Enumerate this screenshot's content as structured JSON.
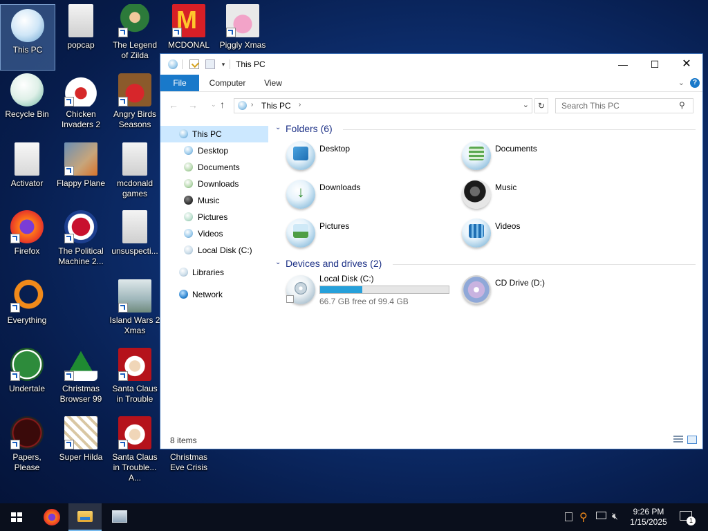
{
  "desktop": {
    "icons": [
      {
        "label": "This PC"
      },
      {
        "label": "popcap"
      },
      {
        "label": "The Legend of Zilda"
      },
      {
        "label": "MCDONAL"
      },
      {
        "label": "Piggly Xmas"
      },
      {
        "label": "Recycle Bin"
      },
      {
        "label": "Chicken Invaders 2"
      },
      {
        "label": "Angry Birds Seasons"
      },
      {
        "label": "Activator"
      },
      {
        "label": "Flappy Plane"
      },
      {
        "label": "mcdonald games"
      },
      {
        "label": "Firefox"
      },
      {
        "label": "The Political Machine 2..."
      },
      {
        "label": "unsuspecti..."
      },
      {
        "label": "Everything"
      },
      {
        "label": "Island Wars 2 Xmas"
      },
      {
        "label": "Undertale"
      },
      {
        "label": "Christmas Browser 99"
      },
      {
        "label": "Santa Claus in Trouble"
      },
      {
        "label": "Papers, Please"
      },
      {
        "label": "Super Hilda"
      },
      {
        "label": "Santa Claus in Trouble... A..."
      },
      {
        "label": "Christmas Eve Crisis"
      }
    ]
  },
  "explorer": {
    "title": "This PC",
    "tabs": [
      "File",
      "Computer",
      "View"
    ],
    "address": {
      "location": "This PC"
    },
    "search_placeholder": "Search This PC",
    "nav": [
      {
        "label": "This PC"
      },
      {
        "label": "Desktop"
      },
      {
        "label": "Documents"
      },
      {
        "label": "Downloads"
      },
      {
        "label": "Music"
      },
      {
        "label": "Pictures"
      },
      {
        "label": "Videos"
      },
      {
        "label": "Local Disk (C:)"
      },
      {
        "label": "Libraries"
      },
      {
        "label": "Network"
      }
    ],
    "folders_header": "Folders (6)",
    "folders": [
      {
        "label": "Desktop"
      },
      {
        "label": "Documents"
      },
      {
        "label": "Downloads"
      },
      {
        "label": "Music"
      },
      {
        "label": "Pictures"
      },
      {
        "label": "Videos"
      }
    ],
    "devices_header": "Devices and drives (2)",
    "drives": [
      {
        "label": "Local Disk (C:)",
        "free_text": "66.7 GB free of 99.4 GB",
        "used_fraction": 0.329
      },
      {
        "label": "CD Drive (D:)"
      }
    ],
    "status": "8 items"
  },
  "taskbar": {
    "time": "9:26 PM",
    "date": "1/15/2025",
    "notification_count": "1"
  },
  "colors": {
    "accent": "#1979ca",
    "selection": "#cce8ff",
    "drive_bar": "#26a0da",
    "group_header": "#1e3287"
  }
}
